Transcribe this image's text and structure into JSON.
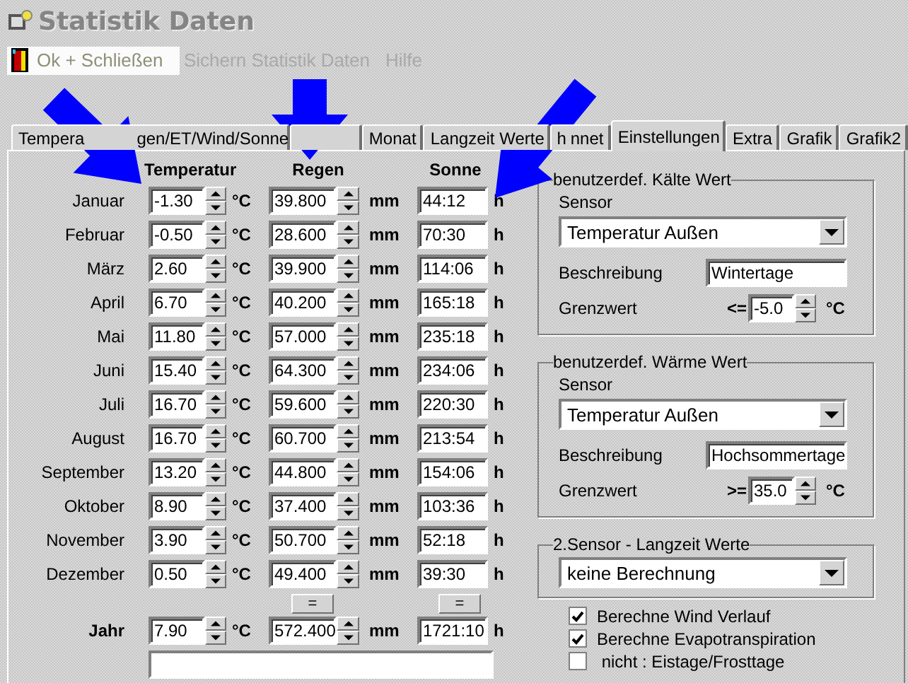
{
  "window": {
    "title": "Statistik Daten"
  },
  "menu": [
    {
      "label": "Ok + Schließen",
      "kind": "exit",
      "selected": true
    },
    {
      "label": "Sichern Statistik Daten",
      "kind": "plain",
      "selected": false
    },
    {
      "label": "Hilfe",
      "kind": "plain",
      "selected": false
    }
  ],
  "tabs": [
    {
      "parts": [
        "Tempera",
        "gen/ET/Wind/Sonne"
      ],
      "selected": false
    },
    {
      "selected": false
    },
    {
      "parts": [
        "Monat"
      ],
      "selected": false
    },
    {
      "parts": [
        "Langzeit Werte"
      ],
      "selected": false
    },
    {
      "parts": [
        "h",
        "nnet"
      ],
      "selected": false
    },
    {
      "parts": [
        "Einstellungen"
      ],
      "selected": true
    },
    {
      "parts": [
        "Extra"
      ],
      "selected": false
    },
    {
      "parts": [
        "Grafik"
      ],
      "selected": false
    },
    {
      "parts": [
        "Grafik2"
      ],
      "selected": false
    }
  ],
  "columns": [
    "Temperatur",
    "Regen",
    "Sonne"
  ],
  "rows": [
    {
      "month": "Januar",
      "temperature": "-1.30",
      "temp_unit": "°C",
      "rain": "39.800",
      "rain_unit": "mm",
      "sun": "44:12",
      "sun_unit": "h"
    },
    {
      "month": "Februar",
      "temperature": "-0.50",
      "temp_unit": "°C",
      "rain": "28.600",
      "rain_unit": "mm",
      "sun": "70:30",
      "sun_unit": "h"
    },
    {
      "month": "März",
      "temperature": "2.60",
      "temp_unit": "°C",
      "rain": "39.900",
      "rain_unit": "mm",
      "sun": "114:06",
      "sun_unit": "h"
    },
    {
      "month": "April",
      "temperature": "6.70",
      "temp_unit": "°C",
      "rain": "40.200",
      "rain_unit": "mm",
      "sun": "165:18",
      "sun_unit": "h"
    },
    {
      "month": "Mai",
      "temperature": "11.80",
      "temp_unit": "°C",
      "rain": "57.000",
      "rain_unit": "mm",
      "sun": "235:18",
      "sun_unit": "h"
    },
    {
      "month": "Juni",
      "temperature": "15.40",
      "temp_unit": "°C",
      "rain": "64.300",
      "rain_unit": "mm",
      "sun": "234:06",
      "sun_unit": "h"
    },
    {
      "month": "Juli",
      "temperature": "16.70",
      "temp_unit": "°C",
      "rain": "59.600",
      "rain_unit": "mm",
      "sun": "220:30",
      "sun_unit": "h"
    },
    {
      "month": "August",
      "temperature": "16.70",
      "temp_unit": "°C",
      "rain": "60.700",
      "rain_unit": "mm",
      "sun": "213:54",
      "sun_unit": "h"
    },
    {
      "month": "September",
      "temperature": "13.20",
      "temp_unit": "°C",
      "rain": "44.800",
      "rain_unit": "mm",
      "sun": "154:06",
      "sun_unit": "h"
    },
    {
      "month": "Oktober",
      "temperature": "8.90",
      "temp_unit": "°C",
      "rain": "37.400",
      "rain_unit": "mm",
      "sun": "103:36",
      "sun_unit": "h"
    },
    {
      "month": "November",
      "temperature": "3.90",
      "temp_unit": "°C",
      "rain": "50.700",
      "rain_unit": "mm",
      "sun": "52:18",
      "sun_unit": "h"
    },
    {
      "month": "Dezember",
      "temperature": "0.50",
      "temp_unit": "°C",
      "rain": "49.400",
      "rain_unit": "mm",
      "sun": "39:30",
      "sun_unit": "h"
    }
  ],
  "sum_buttons": [
    "=",
    "="
  ],
  "total": {
    "label": "Jahr",
    "temperature": "7.90",
    "temp_unit": "°C",
    "rain": "572.400",
    "rain_unit": "mm",
    "sun": "1721:10",
    "sun_unit": "h"
  },
  "thresholds": [
    {
      "title": "benutzerdef. Kälte Wert",
      "sensor_label": "Sensor",
      "sensor": "Temperatur Außen",
      "description_label": "Beschreibung",
      "description": "Wintertage",
      "limit_label": "Grenzwert",
      "operator": "<=",
      "limit": "-5.0",
      "unit": "°C"
    },
    {
      "title": "benutzerdef. Wärme Wert",
      "sensor_label": "Sensor",
      "sensor": "Temperatur Außen",
      "description_label": "Beschreibung",
      "description": "Hochsommertage",
      "limit_label": "Grenzwert",
      "operator": ">=",
      "limit": "35.0",
      "unit": "°C"
    }
  ],
  "sensor2": {
    "title": "2.Sensor - Langzeit Werte",
    "value": "keine Berechnung"
  },
  "options": [
    {
      "label": "Berechne Wind Verlauf",
      "checked": true
    },
    {
      "label": "Berechne Evapotranspiration",
      "checked": true
    },
    {
      "label": " nicht : Eistage/Frosttage",
      "checked": false
    }
  ]
}
